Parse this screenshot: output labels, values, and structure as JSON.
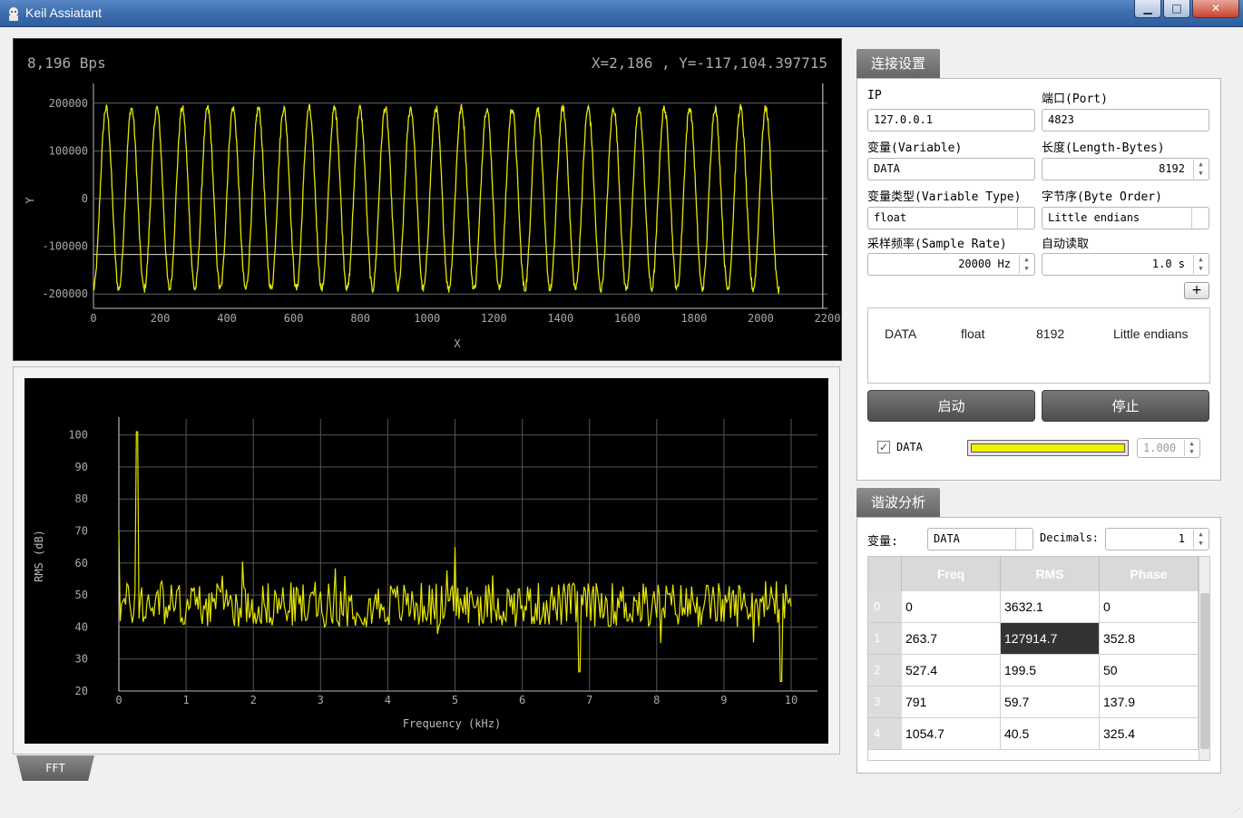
{
  "window": {
    "title": "Keil Assiatant",
    "minimize_glyph": "▁",
    "maximize_glyph": "□",
    "close_glyph": "✕"
  },
  "waveform": {
    "rate_text": "8,196 Bps",
    "cursor_text": "X=2,186 , Y=-117,104.397715",
    "x_label": "X",
    "y_label": "Y",
    "line_color": "#e6e600"
  },
  "fft": {
    "tab_label": "FFT",
    "x_label": "Frequency (kHz)",
    "y_label": "RMS (dB)",
    "line_color": "#e6e600"
  },
  "connection": {
    "group_title": "连接设置",
    "ip_label": "IP",
    "ip_value": "127.0.0.1",
    "port_label": "端口(Port)",
    "port_value": "4823",
    "variable_label": "变量(Variable)",
    "variable_value": "DATA",
    "length_label": "长度(Length-Bytes)",
    "length_value": "8192",
    "vartype_label": "变量类型(Variable Type)",
    "vartype_value": "float",
    "byteorder_label": "字节序(Byte Order)",
    "byteorder_value": "Little endians",
    "samplerate_label": "采样频率(Sample Rate)",
    "samplerate_value": "20000 Hz",
    "autoread_label": "自动读取",
    "autoread_value": "1.0 s",
    "add_label": "+",
    "list_row": [
      "DATA",
      "float",
      "8192",
      "Little endians"
    ],
    "start_label": "启动",
    "stop_label": "停止",
    "series_checkbox_label": "DATA",
    "series_checked": "✓",
    "series_color": "#f0f000",
    "series_scale": "1.000"
  },
  "harmonic": {
    "group_title": "谐波分析",
    "variable_label": "变量:",
    "variable_value": "DATA",
    "decimals_label": "Decimals:",
    "decimals_value": "1",
    "columns": [
      "Freq",
      "RMS",
      "Phase"
    ],
    "rows": [
      {
        "index": "0",
        "freq": "0",
        "rms": "3632.1",
        "phase": "0"
      },
      {
        "index": "1",
        "freq": "263.7",
        "rms": "127914.7",
        "phase": "352.8"
      },
      {
        "index": "2",
        "freq": "527.4",
        "rms": "199.5",
        "phase": "50"
      },
      {
        "index": "3",
        "freq": "791",
        "rms": "59.7",
        "phase": "137.9"
      },
      {
        "index": "4",
        "freq": "1054.7",
        "rms": "40.5",
        "phase": "325.4"
      }
    ],
    "selected_row": 1
  },
  "chart_data": [
    {
      "type": "line",
      "title": "",
      "xlabel": "X",
      "ylabel": "Y",
      "xlim": [
        0,
        2200
      ],
      "ylim": [
        -230000,
        230000
      ],
      "x_ticks": [
        0,
        200,
        400,
        600,
        800,
        1000,
        1200,
        1400,
        1600,
        1800,
        2000,
        2200
      ],
      "y_ticks": [
        200000,
        100000,
        0,
        -100000,
        -200000
      ],
      "y_tick_labels": [
        "200000",
        "100000",
        "0",
        "-100000",
        "-200000"
      ],
      "series": [
        {
          "color": "#e6e600",
          "amplitude": 190000,
          "cycles_per_unit": 0.01315,
          "x_start": 0,
          "x_end": 2055
        }
      ],
      "markers": {
        "cursor_x": 2186,
        "horizontal_line_y": -117104
      }
    },
    {
      "type": "line",
      "title": "",
      "xlabel": "Frequency (kHz)",
      "ylabel": "RMS (dB)",
      "xlim": [
        0,
        10
      ],
      "ylim": [
        20,
        105
      ],
      "x_ticks": [
        0,
        1,
        2,
        3,
        4,
        5,
        6,
        7,
        8,
        9,
        10
      ],
      "y_ticks": [
        20,
        30,
        40,
        50,
        60,
        70,
        80,
        90,
        100
      ],
      "series": [
        {
          "color": "#e6e600",
          "baseline": 47,
          "noise": 7,
          "peaks": [
            {
              "x": 0.0,
              "y": 70
            },
            {
              "x": 0.27,
              "y": 101
            },
            {
              "x": 5.0,
              "y": 65
            },
            {
              "x": 9.85,
              "y": 23
            },
            {
              "x": 6.85,
              "y": 26
            }
          ]
        }
      ]
    }
  ]
}
